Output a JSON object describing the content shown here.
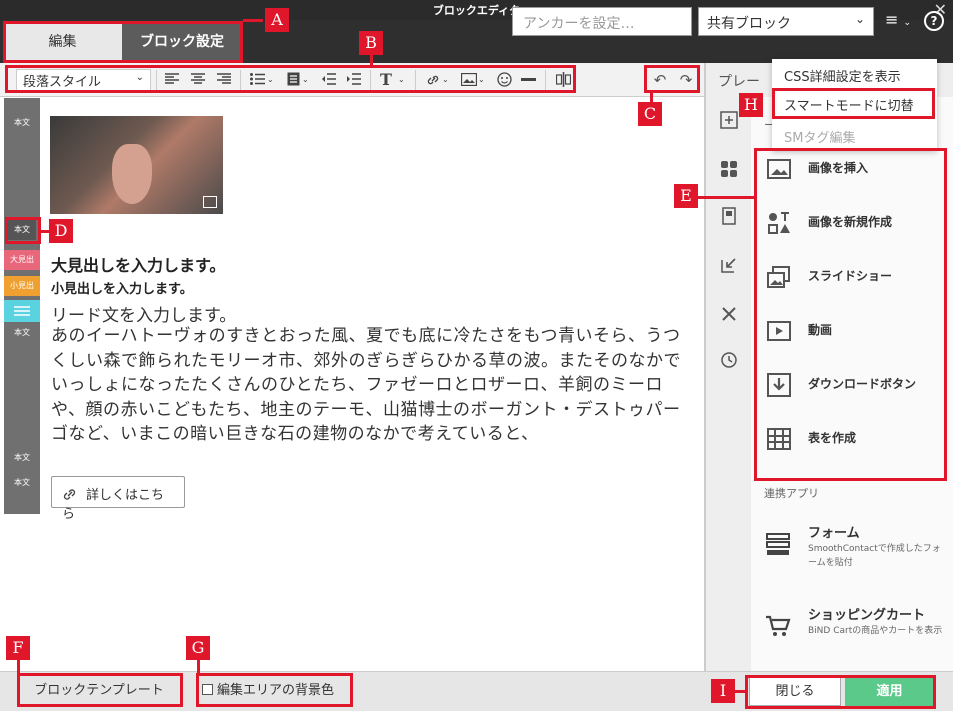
{
  "window": {
    "title": "ブロックエディタ",
    "close_glyph": "✕"
  },
  "header": {
    "tabs": [
      {
        "label": "編集"
      },
      {
        "label": "ブロック設定"
      }
    ],
    "anchor_placeholder": "アンカーを設定…",
    "shared_block": "共有ブロック",
    "menu_glyph": "≡",
    "help_glyph": "?"
  },
  "toolbar": {
    "paragraph_style": "段落スタイル",
    "text_glyph": "T",
    "undo_glyph": "↶",
    "redo_glyph": "↷"
  },
  "gutter": {
    "tags": [
      "本文",
      "本文",
      "大見出",
      "小見出",
      "本文",
      "本文",
      "本文"
    ]
  },
  "content": {
    "heading_large": "大見出しを入力します。",
    "heading_small": "小見出しを入力します。",
    "lead": "リード文を入力します。",
    "body": "あのイーハトーヴォのすきとおった風、夏でも底に冷たさをもつ青いそら、うつくしい森で飾られたモリーオ市、郊外のぎらぎらひかる草の波。またそのなかでいっしょになったたくさんのひとたち、ファゼーロとロザーロ、羊飼のミーロや、顔の赤いこどもたち、地主のテーモ、山猫博士のボーガント・デストゥパーゴなど、いまこの暗い巨きな石の建物のなかで考えていると、",
    "more_button": "詳しくはこちら"
  },
  "right_panel": {
    "tab_label": "プレー",
    "dash": "ー",
    "items": [
      {
        "label": "画像を挿入",
        "icon": "image-icon"
      },
      {
        "label": "画像を新規作成",
        "icon": "shapes-icon"
      },
      {
        "label": "スライドショー",
        "icon": "slideshow-icon"
      },
      {
        "label": "動画",
        "icon": "video-icon"
      },
      {
        "label": "ダウンロードボタン",
        "icon": "download-icon"
      },
      {
        "label": "表を作成",
        "icon": "table-icon"
      }
    ],
    "section_label": "連携アプリ",
    "apps": [
      {
        "title": "フォーム",
        "desc": "SmoothContactで作成したフォームを貼付"
      },
      {
        "title": "ショッピングカート",
        "desc": "BiND Cartの商品やカートを表示"
      }
    ]
  },
  "dropdown": {
    "items": [
      "CSS詳細設定を表示",
      "スマートモードに切替",
      "SMタグ編集"
    ]
  },
  "footer": {
    "template_button": "ブロックテンプレート",
    "bg_checkbox": "編集エリアの背景色",
    "close_button": "閉じる",
    "apply_button": "適用"
  },
  "annotations": [
    "A",
    "B",
    "C",
    "D",
    "E",
    "F",
    "G",
    "H",
    "I"
  ],
  "colors": {
    "accent_red": "#e0162b",
    "apply_green": "#5bc98a",
    "dark": "#2f2f2f"
  }
}
